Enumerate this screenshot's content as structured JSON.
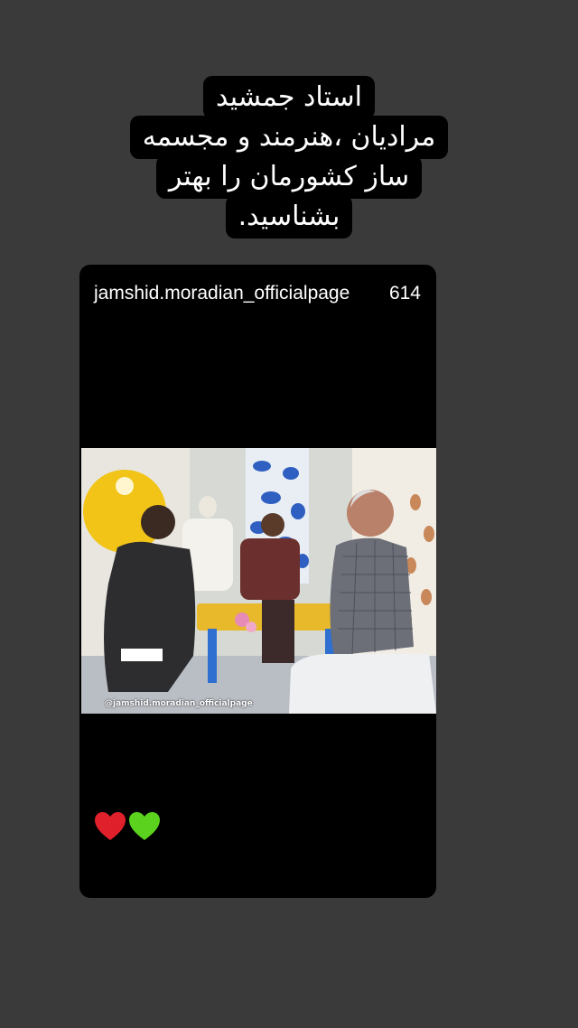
{
  "caption": {
    "lines": [
      "استاد جمشید",
      "مرادیان ،هنرمند و مجسمه",
      "ساز کشورمان را بهتر",
      "بشناسید."
    ]
  },
  "post": {
    "username": "jamshid.moradian_officialpage",
    "time_ago": "614",
    "video_watermark": "@jamshid.moradian_officialpage",
    "reactions": [
      {
        "icon": "red-heart-icon",
        "color": "#e0202a"
      },
      {
        "icon": "green-heart-icon",
        "color": "#5ad21e"
      }
    ]
  },
  "colors": {
    "background": "#3a3a3a",
    "card": "#000000",
    "caption_bg": "#000000",
    "text": "#ffffff"
  }
}
